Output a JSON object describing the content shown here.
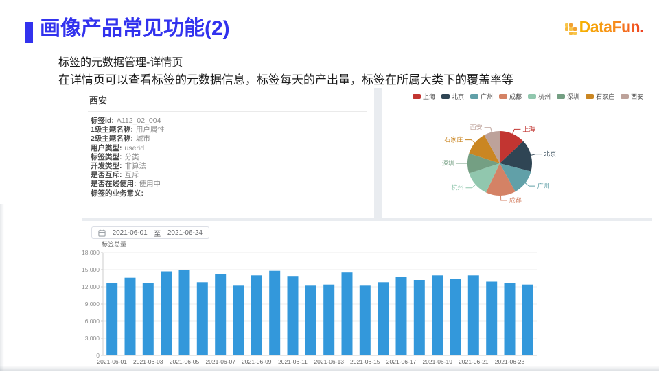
{
  "slide": {
    "title": "画像产品常见功能(2)",
    "subtitle1": "标签的元数据管理-详情页",
    "subtitle2": "在详情页可以查看标签的元数据信息，标签每天的产出量，标签在所属大类下的覆盖率等",
    "accent_color": "#3232ee",
    "logo_text": "DataFun."
  },
  "detail_panel": {
    "title": "西安",
    "fields": [
      {
        "label": "标签id:",
        "value": "A112_02_004"
      },
      {
        "label": "1级主题名称:",
        "value": "用户属性"
      },
      {
        "label": "2级主题名称:",
        "value": "城市"
      },
      {
        "label": "用户类型:",
        "value": "userid"
      },
      {
        "label": "标签类型:",
        "value": "分类"
      },
      {
        "label": "开发类型:",
        "value": "非算法"
      },
      {
        "label": "是否互斥:",
        "value": "互斥"
      },
      {
        "label": "是否在线使用:",
        "value": "使用中"
      },
      {
        "label": "标签的业务意义:",
        "value": ""
      }
    ]
  },
  "date_filter": {
    "icon": "calendar-icon",
    "start": "2021-06-01",
    "separator": "至",
    "end": "2021-06-24"
  },
  "chart_data": [
    {
      "type": "pie",
      "title": "",
      "labels": [
        "上海",
        "北京",
        "广州",
        "成都",
        "杭州",
        "深圳",
        "石家庄",
        "西安"
      ],
      "values": [
        13,
        16,
        13,
        15,
        13,
        10,
        12,
        8
      ],
      "colors": [
        "#c23531",
        "#2f4554",
        "#61a0a8",
        "#d48265",
        "#91c7ae",
        "#749f83",
        "#ca8622",
        "#bda29a"
      ],
      "legend_position": "top"
    },
    {
      "type": "bar",
      "title": "标签总量",
      "categories": [
        "2021-06-01",
        "2021-06-02",
        "2021-06-03",
        "2021-06-04",
        "2021-06-05",
        "2021-06-06",
        "2021-06-07",
        "2021-06-08",
        "2021-06-09",
        "2021-06-10",
        "2021-06-11",
        "2021-06-12",
        "2021-06-13",
        "2021-06-14",
        "2021-06-15",
        "2021-06-16",
        "2021-06-17",
        "2021-06-18",
        "2021-06-19",
        "2021-06-20",
        "2021-06-21",
        "2021-06-22",
        "2021-06-23",
        "2021-06-24"
      ],
      "values": [
        12600,
        13600,
        12700,
        14700,
        15000,
        12800,
        14200,
        12200,
        14000,
        14800,
        13900,
        12200,
        12400,
        14500,
        12200,
        12800,
        13800,
        13200,
        14000,
        13400,
        14000,
        12900,
        12600,
        12400
      ],
      "xlabel": "",
      "ylabel": "标签总量",
      "ylim": [
        0,
        18000
      ],
      "ytick_step": 3000,
      "x_label_every": 2,
      "bar_color": "#3398db",
      "grid": true
    }
  ]
}
